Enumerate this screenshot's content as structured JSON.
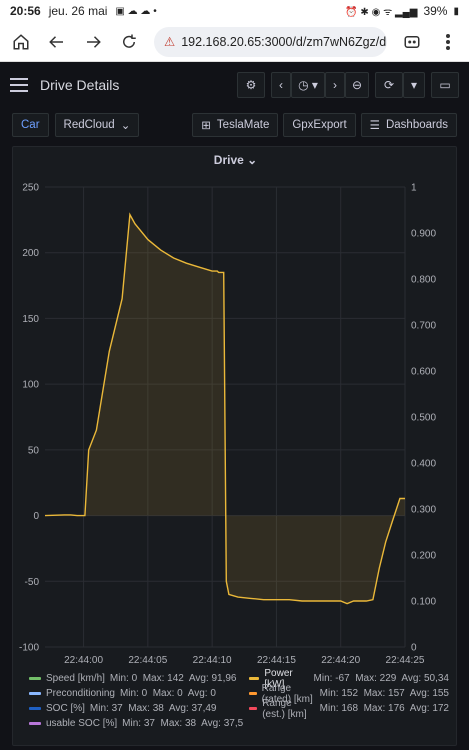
{
  "status": {
    "time": "20:56",
    "date": "jeu. 26 mai",
    "battery": "39%"
  },
  "browser": {
    "url": "192.168.20.65:3000/d/zm7wN6Zgz/drive-"
  },
  "header": {
    "title": "Drive Details"
  },
  "variables": {
    "car_label": "Car",
    "car_value": "RedCloud"
  },
  "links": {
    "teslamate": "TeslaMate",
    "gpxexport": "GpxExport",
    "dashboards": "Dashboards"
  },
  "panel": {
    "title": "Drive"
  },
  "colors": {
    "power": "#eab839",
    "speed": "#73bf69",
    "soc": "#1f60c4",
    "precond": "#8ab8ff",
    "range_rated": "#ff9830",
    "range_est": "#f2495c",
    "usable_soc": "#b877d9"
  },
  "chart_data": {
    "type": "line",
    "title": "Drive",
    "xlabel": "",
    "ylabel": "",
    "x_ticks": [
      "22:44:00",
      "22:44:05",
      "22:44:10",
      "22:44:15",
      "22:44:20",
      "22:44:25"
    ],
    "y_left_ticks": [
      "250",
      "200",
      "150",
      "100",
      "50",
      "0",
      "-50",
      "-100"
    ],
    "y_right_ticks": [
      "1",
      "0.900",
      "0.800",
      "0.700",
      "0.600",
      "0.500",
      "0.400",
      "0.300",
      "0.200",
      "0.100",
      "0"
    ],
    "ylim_left": [
      -100,
      250
    ],
    "ylim_right": [
      0,
      1
    ],
    "xlim_seconds": [
      -3,
      25
    ],
    "series": [
      {
        "name": "Power [kW]",
        "axis": "left",
        "values": [
          [
            -3,
            0
          ],
          [
            -1.5,
            0.5
          ],
          [
            -1,
            0.5
          ],
          [
            -0.5,
            0
          ],
          [
            0,
            0
          ],
          [
            0.1,
            0
          ],
          [
            0.4,
            50
          ],
          [
            1,
            65
          ],
          [
            2,
            125
          ],
          [
            3,
            165
          ],
          [
            3.6,
            229
          ],
          [
            4,
            222
          ],
          [
            5,
            210
          ],
          [
            6,
            202
          ],
          [
            7,
            196
          ],
          [
            8,
            192
          ],
          [
            9,
            189
          ],
          [
            10,
            186
          ],
          [
            10.4,
            186
          ],
          [
            10.5,
            185
          ],
          [
            10.9,
            185
          ],
          [
            11.1,
            -50
          ],
          [
            11.3,
            -60
          ],
          [
            12,
            -62
          ],
          [
            13,
            -63
          ],
          [
            14,
            -64
          ],
          [
            15,
            -64
          ],
          [
            16,
            -64
          ],
          [
            17,
            -65
          ],
          [
            18,
            -65
          ],
          [
            19,
            -65
          ],
          [
            20,
            -65
          ],
          [
            20.5,
            -67
          ],
          [
            21,
            -65
          ],
          [
            22,
            -65
          ],
          [
            22.5,
            -64
          ],
          [
            23,
            -40
          ],
          [
            23.5,
            -20
          ],
          [
            24,
            -5
          ],
          [
            24.6,
            13
          ],
          [
            25,
            13
          ]
        ]
      }
    ],
    "legend": [
      {
        "name": "Speed [km/h]",
        "stats": "Min: 0  Max: 142  Avg: 91,96"
      },
      {
        "name": "Power [kW]",
        "stats": "Min: -67  Max: 229  Avg: 50,34"
      },
      {
        "name": "Preconditioning",
        "stats": "Min: 0  Max: 0  Avg: 0"
      },
      {
        "name": "Range (rated) [km]",
        "stats": "Min: 152  Max: 157  Avg: 155"
      },
      {
        "name": "SOC [%]",
        "stats": "Min: 37  Max: 38  Avg: 37,49"
      },
      {
        "name": "Range (est.) [km]",
        "stats": "Min: 168  Max: 176  Avg: 172"
      },
      {
        "name": "usable SOC [%]",
        "stats": "Min: 37  Max: 38  Avg: 37,5"
      }
    ]
  }
}
